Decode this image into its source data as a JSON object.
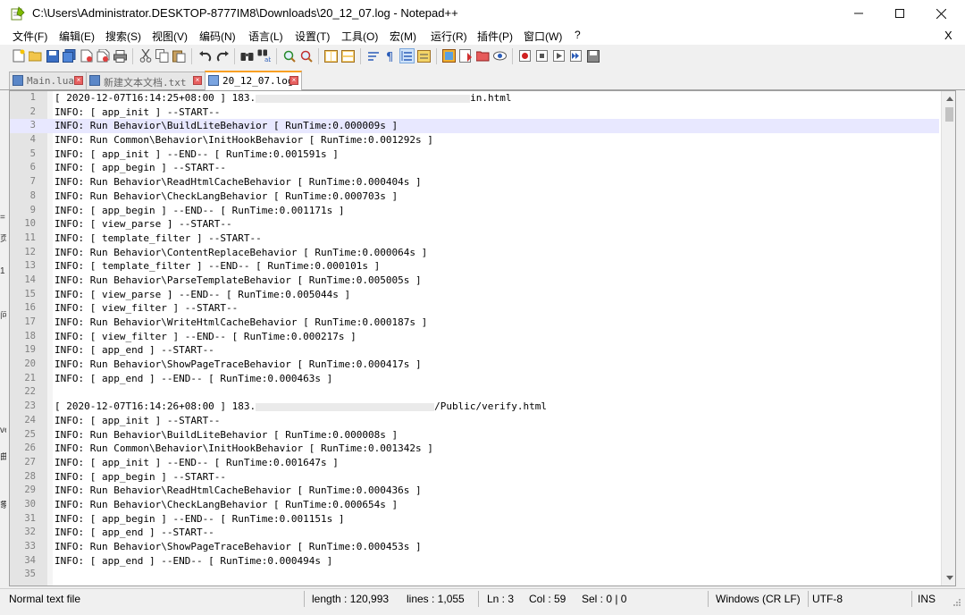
{
  "window": {
    "title": "C:\\Users\\Administrator.DESKTOP-8777IM8\\Downloads\\20_12_07.log - Notepad++",
    "minimize": "—",
    "maximize": "☐",
    "close": "✕"
  },
  "menu": {
    "items": [
      "文件(F)",
      "编辑(E)",
      "搜索(S)",
      "视图(V)",
      "编码(N)",
      "语言(L)",
      "设置(T)",
      "工具(O)",
      "宏(M)",
      "运行(R)",
      "插件(P)",
      "窗口(W)",
      "?"
    ],
    "close_doc": "X"
  },
  "toolbar": {
    "icons": [
      "new-file-icon",
      "open-file-icon",
      "save-icon",
      "save-all-icon",
      "close-file-icon",
      "close-all-icon",
      "print-icon",
      "cut-icon",
      "copy-icon",
      "paste-icon",
      "undo-icon",
      "redo-icon",
      "find-icon",
      "replace-icon",
      "zoom-in-icon",
      "zoom-out-icon",
      "sync-vertical-icon",
      "sync-horizontal-icon",
      "word-wrap-icon",
      "show-all-chars-icon",
      "indent-guide-icon",
      "udl-icon",
      "doc-map-icon",
      "function-list-icon",
      "folder-workspace-icon",
      "monitoring-icon",
      "record-macro-icon",
      "stop-macro-icon",
      "play-macro-icon",
      "run-macro-multiple-icon",
      "save-macro-icon"
    ]
  },
  "tabs": [
    {
      "label": "Main.lua",
      "active": false
    },
    {
      "label": "新建文本文档.txt",
      "active": false
    },
    {
      "label": "20_12_07.log",
      "active": true
    }
  ],
  "editor": {
    "current_line": 3,
    "lines": [
      {
        "n": "1",
        "text": "[ 2020-12-07T16:14:25+08:00 ] 183.",
        "redacted_tail": "in.html"
      },
      {
        "n": "2",
        "text": "INFO: [ app_init ] --START--"
      },
      {
        "n": "3",
        "text": "INFO: Run Behavior\\BuildLiteBehavior [ RunTime:0.000009s ]"
      },
      {
        "n": "4",
        "text": "INFO: Run Common\\Behavior\\InitHookBehavior [ RunTime:0.001292s ]"
      },
      {
        "n": "5",
        "text": "INFO: [ app_init ] --END-- [ RunTime:0.001591s ]"
      },
      {
        "n": "6",
        "text": "INFO: [ app_begin ] --START--"
      },
      {
        "n": "7",
        "text": "INFO: Run Behavior\\ReadHtmlCacheBehavior [ RunTime:0.000404s ]"
      },
      {
        "n": "8",
        "text": "INFO: Run Behavior\\CheckLangBehavior [ RunTime:0.000703s ]"
      },
      {
        "n": "9",
        "text": "INFO: [ app_begin ] --END-- [ RunTime:0.001171s ]"
      },
      {
        "n": "10",
        "text": "INFO: [ view_parse ] --START--"
      },
      {
        "n": "11",
        "text": "INFO: [ template_filter ] --START--"
      },
      {
        "n": "12",
        "text": "INFO: Run Behavior\\ContentReplaceBehavior [ RunTime:0.000064s ]"
      },
      {
        "n": "13",
        "text": "INFO: [ template_filter ] --END-- [ RunTime:0.000101s ]"
      },
      {
        "n": "14",
        "text": "INFO: Run Behavior\\ParseTemplateBehavior [ RunTime:0.005005s ]"
      },
      {
        "n": "15",
        "text": "INFO: [ view_parse ] --END-- [ RunTime:0.005044s ]"
      },
      {
        "n": "16",
        "text": "INFO: [ view_filter ] --START--"
      },
      {
        "n": "17",
        "text": "INFO: Run Behavior\\WriteHtmlCacheBehavior [ RunTime:0.000187s ]"
      },
      {
        "n": "18",
        "text": "INFO: [ view_filter ] --END-- [ RunTime:0.000217s ]"
      },
      {
        "n": "19",
        "text": "INFO: [ app_end ] --START--"
      },
      {
        "n": "20",
        "text": "INFO: Run Behavior\\ShowPageTraceBehavior [ RunTime:0.000417s ]"
      },
      {
        "n": "21",
        "text": "INFO: [ app_end ] --END-- [ RunTime:0.000463s ]"
      },
      {
        "n": "22",
        "text": ""
      },
      {
        "n": "23",
        "text": "[ 2020-12-07T16:14:26+08:00 ] 183.",
        "redacted_tail": "/Public/verify.html"
      },
      {
        "n": "24",
        "text": "INFO: [ app_init ] --START--"
      },
      {
        "n": "25",
        "text": "INFO: Run Behavior\\BuildLiteBehavior [ RunTime:0.000008s ]"
      },
      {
        "n": "26",
        "text": "INFO: Run Common\\Behavior\\InitHookBehavior [ RunTime:0.001342s ]"
      },
      {
        "n": "27",
        "text": "INFO: [ app_init ] --END-- [ RunTime:0.001647s ]"
      },
      {
        "n": "28",
        "text": "INFO: [ app_begin ] --START--"
      },
      {
        "n": "29",
        "text": "INFO: Run Behavior\\ReadHtmlCacheBehavior [ RunTime:0.000436s ]"
      },
      {
        "n": "30",
        "text": "INFO: Run Behavior\\CheckLangBehavior [ RunTime:0.000654s ]"
      },
      {
        "n": "31",
        "text": "INFO: [ app_begin ] --END-- [ RunTime:0.001151s ]"
      },
      {
        "n": "32",
        "text": "INFO: [ app_end ] --START--"
      },
      {
        "n": "33",
        "text": "INFO: Run Behavior\\ShowPageTraceBehavior [ RunTime:0.000453s ]"
      },
      {
        "n": "34",
        "text": "INFO: [ app_end ] --END-- [ RunTime:0.000494s ]"
      },
      {
        "n": "35",
        "text": ""
      }
    ]
  },
  "status": {
    "file_type": "Normal text file",
    "length": "length : 120,993",
    "lines": "lines : 1,055",
    "ln": "Ln : 3",
    "col": "Col : 59",
    "sel": "Sel : 0 | 0",
    "eol": "Windows (CR LF)",
    "encoding": "UTF-8",
    "mode": "INS"
  },
  "colors": {
    "current_line": "#e8e8ff",
    "gutter": "#e4e4e4",
    "active_tab_accent": "#f9a023"
  }
}
